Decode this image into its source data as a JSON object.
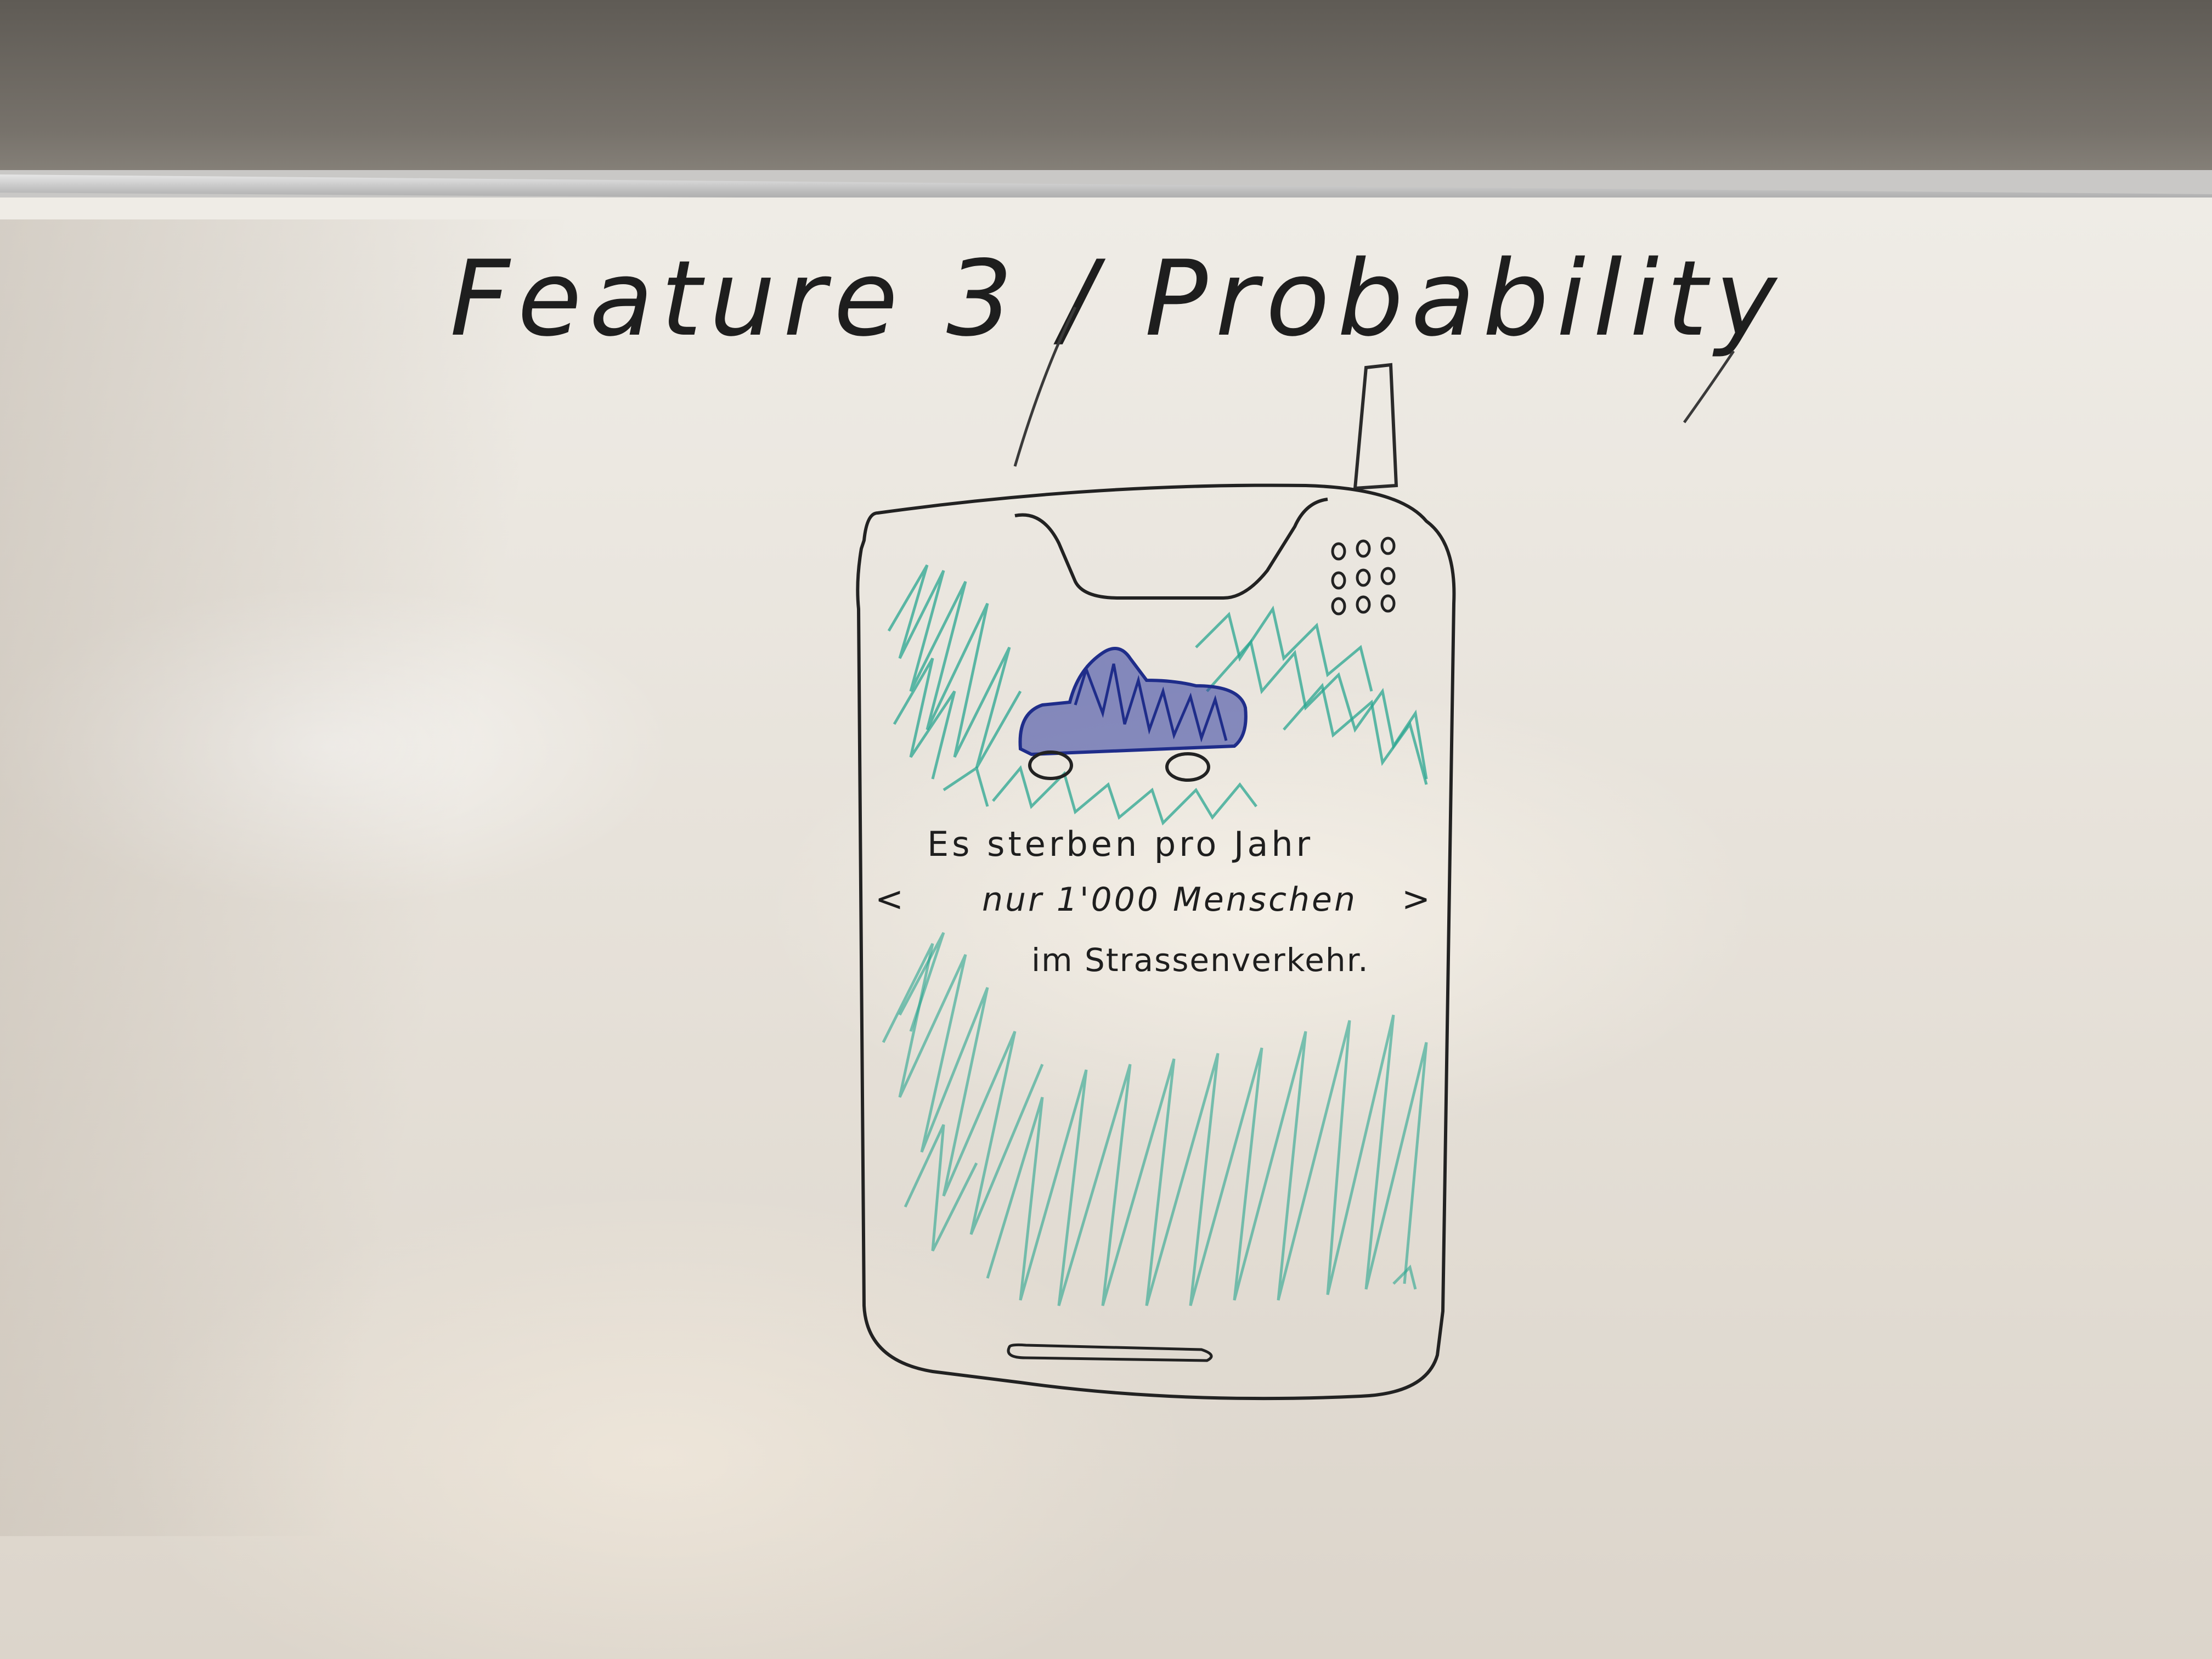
{
  "board": {
    "heading": "Feature 3 / Probability",
    "message": {
      "line1": "Es sterben pro Jahr",
      "line2_prev": "<",
      "line2_text": "nur 1'000 Menschen",
      "line2_next": ">",
      "line3": "im Strassenverkehr."
    }
  },
  "colors": {
    "marker_black": "#1e1e1e",
    "marker_green": "#2aa590",
    "marker_blue": "#1f2d8a",
    "board_white": "#ece8e1"
  },
  "icons": {
    "car": "car-icon",
    "speaker": "speaker-grille-icon",
    "antenna": "antenna-icon"
  }
}
